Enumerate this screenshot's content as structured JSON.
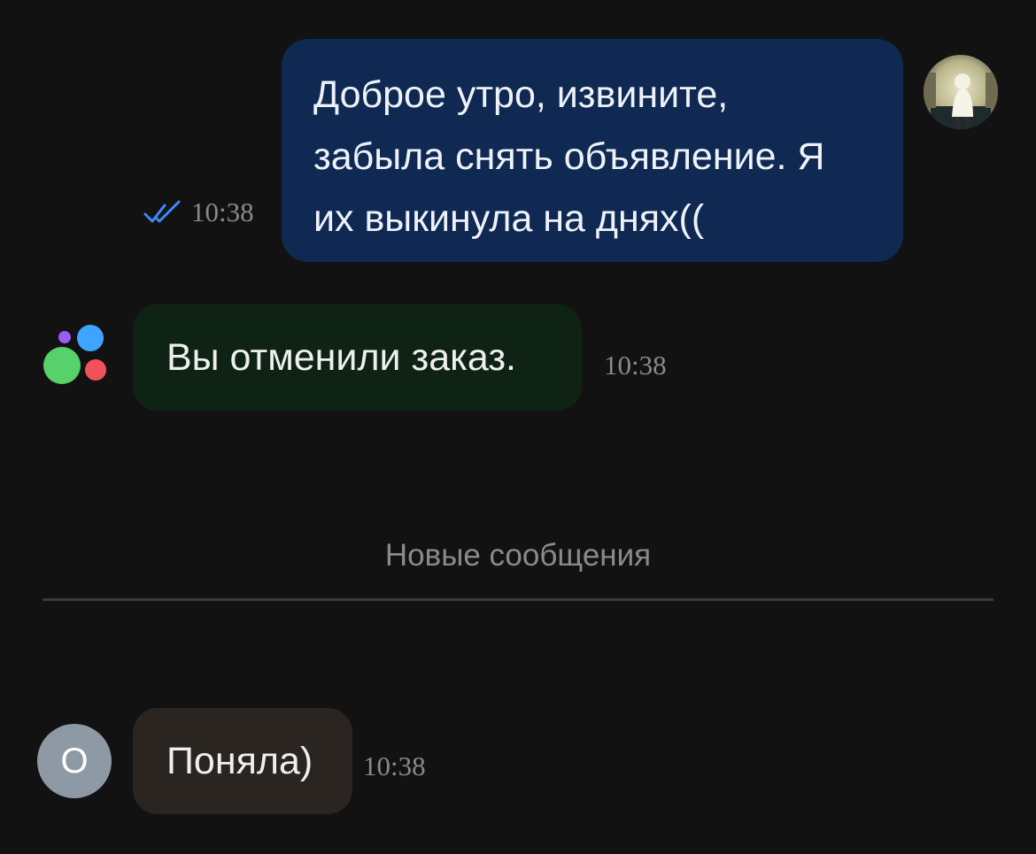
{
  "messages": {
    "outgoing": {
      "lines": [
        "Доброе утро, извините,",
        "забыла снять объявление. Я",
        "их выкинула на днях(("
      ],
      "time": "10:38",
      "status": "read-double-check-icon",
      "bubble_color": "#0f2952",
      "check_color": "#3d8af7"
    },
    "system": {
      "text": "Вы отменили заказ.",
      "time": "10:38",
      "bubble_color": "#0f2315"
    },
    "incoming": {
      "avatar_letter": "О",
      "text": "Поняла)",
      "time": "10:38",
      "bubble_color": "#2a2520"
    }
  },
  "divider": {
    "label": "Новые сообщения"
  },
  "colors": {
    "background": "#121212",
    "logo_dots": [
      "#9b5cf6",
      "#3da5ff",
      "#57d16a",
      "#f0525c"
    ]
  }
}
